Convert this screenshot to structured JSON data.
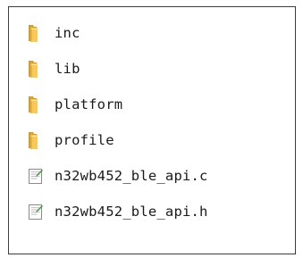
{
  "items": [
    {
      "name": "inc",
      "type": "folder",
      "icon": "folder-icon"
    },
    {
      "name": "lib",
      "type": "folder",
      "icon": "folder-icon"
    },
    {
      "name": "platform",
      "type": "folder",
      "icon": "folder-icon"
    },
    {
      "name": "profile",
      "type": "folder",
      "icon": "folder-icon"
    },
    {
      "name": "n32wb452_ble_api.c",
      "type": "file",
      "icon": "text-file-icon"
    },
    {
      "name": "n32wb452_ble_api.h",
      "type": "file",
      "icon": "text-file-icon"
    }
  ],
  "colors": {
    "folder_back": "#e2a72e",
    "folder_front": "#f7d06b",
    "paper": "#ffffff",
    "paper_border": "#8a8a8a",
    "file_mark": "#3b9a3b"
  }
}
